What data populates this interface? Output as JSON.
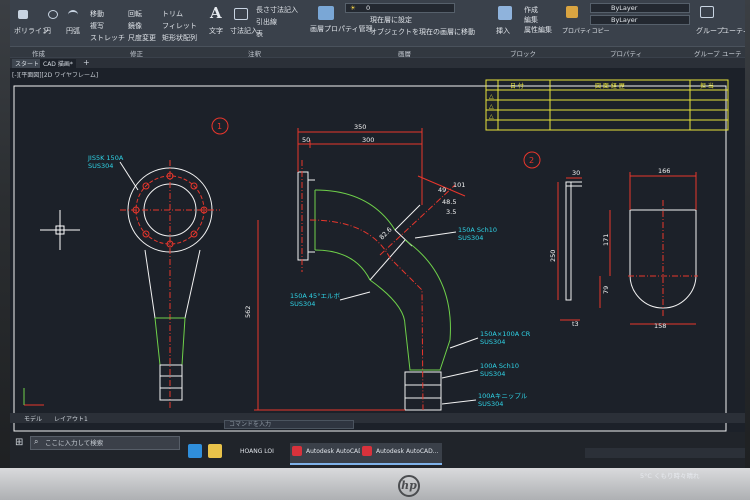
{
  "ribbon": {
    "tools": [
      {
        "label": "ポリライン"
      },
      {
        "label": "円"
      },
      {
        "label": "円弧"
      },
      {
        "label": "移動"
      },
      {
        "label": "回転"
      },
      {
        "label": "トリム"
      },
      {
        "label": "複写"
      },
      {
        "label": "鏡像"
      },
      {
        "label": "フィレット"
      },
      {
        "label": "ストレッチ"
      },
      {
        "label": "尺度変更"
      },
      {
        "label": "矩形状配列"
      },
      {
        "label": "文字"
      },
      {
        "label": "寸法記入"
      },
      {
        "label": "長さ寸法記入"
      },
      {
        "label": "引出線"
      },
      {
        "label": "表"
      },
      {
        "label": "画層プロパティ管理"
      },
      {
        "label": "現在層に設定"
      },
      {
        "label": "オブジェクトを現在の画層に移動"
      },
      {
        "label": "挿入"
      },
      {
        "label": "作成"
      },
      {
        "label": "編集"
      },
      {
        "label": "属性編集"
      },
      {
        "label": "プロパティコピー"
      },
      {
        "label": "グループ"
      },
      {
        "label": "ユーティリティ"
      }
    ],
    "layer_value": "0",
    "bylayer_1": "ByLayer",
    "bylayer_2": "ByLayer",
    "panels": [
      "作成",
      "修正",
      "注釈",
      "画層",
      "ブロック",
      "プロパティ",
      "グループ",
      "ユーティ"
    ]
  },
  "doc_tabs": [
    "スタート",
    "CAD 描画*"
  ],
  "viewport_label": "[-][平面図][2D ワイヤフレーム]",
  "drawing": {
    "title_block": {
      "col1": "日 付",
      "col2": "図 面 経 歴",
      "col3": "担 当"
    },
    "view_markers": [
      "1",
      "2"
    ],
    "labels": [
      {
        "id": "flange",
        "lines": [
          "JIS5K 150A",
          "SUS304"
        ]
      },
      {
        "id": "pipe",
        "lines": [
          "150A Sch10",
          "SUS304"
        ]
      },
      {
        "id": "elbow",
        "lines": [
          "150A 45°エルボ",
          "SUS304"
        ]
      },
      {
        "id": "reducer",
        "lines": [
          "150A×100A CR",
          "SUS304"
        ]
      },
      {
        "id": "pipe100",
        "lines": [
          "100A Sch10",
          "SUS304"
        ]
      },
      {
        "id": "nipple",
        "lines": [
          "100Aキニップル",
          "SUS304"
        ]
      }
    ],
    "dims": {
      "d350": "350",
      "d50": "300",
      "d50b": "50",
      "d562": "562",
      "d101": "101",
      "d49": "49",
      "d485": "48.5",
      "d35": "3.5",
      "d826": "82.6",
      "d30": "30",
      "d250": "250",
      "d166": "166",
      "d171": "171",
      "d79": "79",
      "d158": "158",
      "dt3": "t3"
    }
  },
  "layout_tabs": [
    "モデル",
    "レイアウト1"
  ],
  "cmd_placeholder": "コマンドを入力",
  "taskbar": {
    "search": "ここに入力して検索",
    "apps": [
      "HOANG LOI",
      "Autodesk AutoCAD...",
      "Autodesk AutoCAD..."
    ],
    "weather": "5°C くもり時々晴れ"
  },
  "monitor_brand": "hp",
  "colors": {
    "white_line": "#f2f2f2",
    "red": "#e8362c",
    "green": "#6fd14a",
    "yellow": "#e7e33a",
    "cyan": "#2fd3e6",
    "bg": "#1c2129"
  }
}
